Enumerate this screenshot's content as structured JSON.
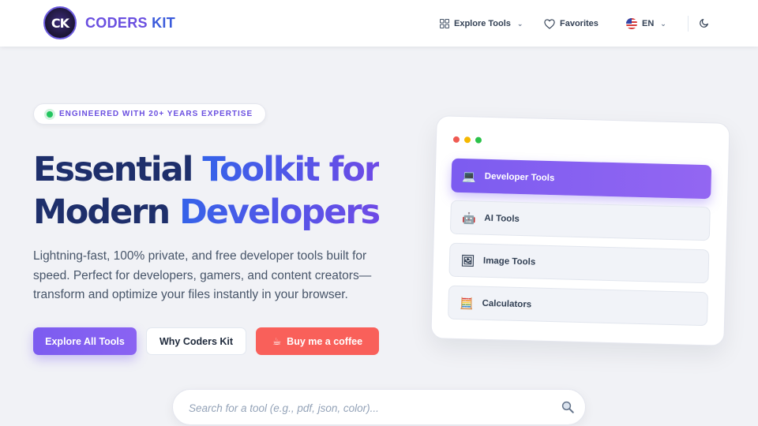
{
  "brand": {
    "logo_text": "CK",
    "name_part1": "CODERS",
    "name_part2": "KIT"
  },
  "nav": {
    "explore_label": "Explore Tools",
    "favorites_label": "Favorites",
    "language_label": "EN"
  },
  "hero": {
    "badge": "ENGINEERED WITH 20+ YEARS EXPERTISE",
    "headline_line1_dark": "Essential ",
    "headline_line1_grad": "Toolkit for",
    "headline_line2_dark": "Modern ",
    "headline_line2_grad": "Developers",
    "subtext": "Lightning-fast, 100% private, and free developer tools built for speed. Perfect for developers, gamers, and content creators—transform and optimize your files instantly in your browser.",
    "btn_explore": "Explore All Tools",
    "btn_why": "Why Coders Kit",
    "btn_coffee_icon": "☕",
    "btn_coffee": "Buy me a coffee"
  },
  "search": {
    "placeholder": "Search for a tool (e.g., pdf, json, color)..."
  },
  "categories": [
    {
      "icon": "💻",
      "icon_name": "laptop-icon",
      "label": "Developer Tools",
      "active": true
    },
    {
      "icon": "🤖",
      "icon_name": "robot-icon",
      "label": "AI Tools",
      "active": false
    },
    {
      "icon": "🖼",
      "icon_name": "picture-icon",
      "label": "Image Tools",
      "active": false
    },
    {
      "icon": "🧮",
      "icon_name": "abacus-icon",
      "label": "Calculators",
      "active": false
    }
  ],
  "colors": {
    "accent": "#7c5cf0",
    "coffee": "#f9605a",
    "dot_red": "#ef5a52",
    "dot_yellow": "#f5b800",
    "dot_green": "#2bc24a"
  }
}
